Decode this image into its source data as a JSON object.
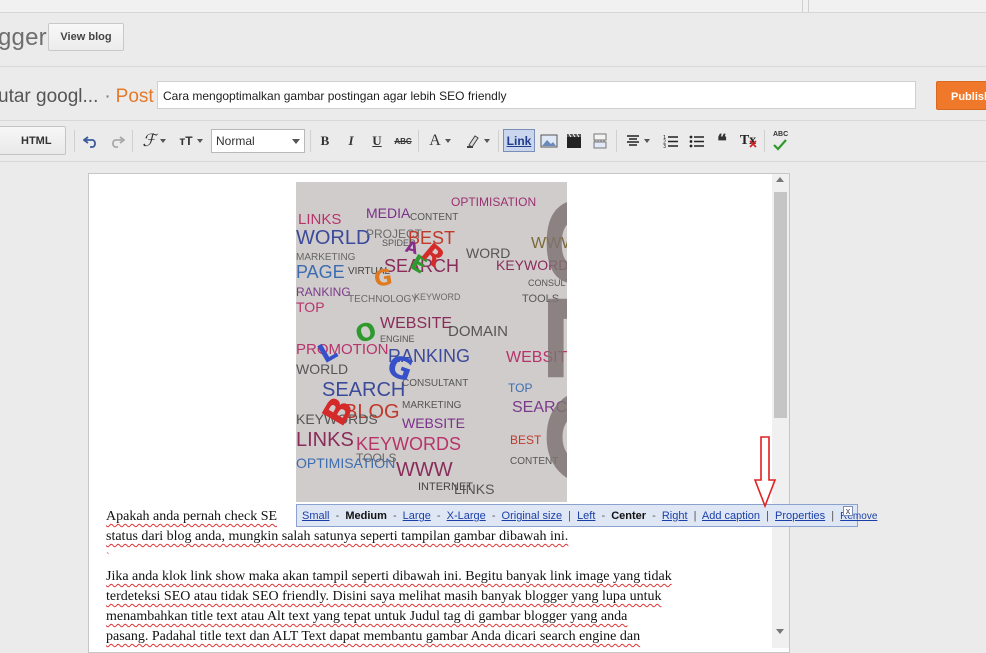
{
  "header": {
    "brand_text": "gger",
    "view_blog_label": "View blog"
  },
  "post_header": {
    "blog_title": "utar googl...",
    "separator": "·",
    "post_label": "Post",
    "title_value": "Cara mengoptimalkan gambar postingan agar lebih SEO friendly",
    "publish_label": "Publish"
  },
  "toolbar": {
    "html_label": "HTML",
    "undo_icon": "undo-icon",
    "redo_icon": "redo-icon",
    "font_icon": "font-family-icon",
    "font_size_icon": "font-size-icon",
    "format_value": "Normal",
    "bold_label": "B",
    "italic_label": "I",
    "underline_label": "U",
    "strike_label": "ABC",
    "text_color_label": "A",
    "link_label": "Link",
    "image_icon": "insert-image-icon",
    "video_icon": "insert-video-icon",
    "jump_break_icon": "jump-break-icon",
    "align_icon": "align-icon",
    "numbered_list_icon": "numbered-list-icon",
    "bullet_list_icon": "bullet-list-icon",
    "quote_label": "❝",
    "remove_format_label": "Tx",
    "spellcheck_label": "ABC"
  },
  "image_toolbar": {
    "small": "Small",
    "medium": "Medium",
    "large": "Large",
    "xlarge": "X-Large",
    "original": "Original size",
    "left": "Left",
    "center": "Center",
    "right": "Right",
    "add_caption": "Add caption",
    "properties": "Properties",
    "remove": "Remove",
    "dash": "-",
    "pipe": "|",
    "close_label": "x"
  },
  "content": {
    "para1_line1": "Apakah anda pernah check SE",
    "para1_line2": "status dari blog anda, mungkin salah satunya seperti tampilan gambar dibawah ini.",
    "stray_mark": "`",
    "para2_line1": "Jika anda klok link show maka akan tampil seperti dibawah ini. Begitu banyak link image yang tidak",
    "para2_line2": "terdeteksi SEO atau tidak SEO friendly. Disini saya melihat masih banyak blogger yang lupa untuk",
    "para2_line3": "menambahkan title text atau Alt text yang  tepat untuk Judul tag di gambar blogger  yang anda",
    "para2_line4": "pasang. Padahal title text dan ALT Text dapat  membantu gambar Anda dicari search engine dan"
  },
  "image_words": {
    "big": "SEO",
    "brand": "BLOGGER",
    "w01": "LINKS",
    "w02": "MEDIA",
    "w03": "CONTENT",
    "w04": "OPTIMISATION",
    "w05": "WORLD",
    "w06": "PROJECT",
    "w07": "BEST",
    "w08": "WWW",
    "w09": "MARKETING",
    "w10": "KEYWORDS",
    "w11": "SEARCH",
    "w12": "PAGE",
    "w13": "VIRTUAL",
    "w14": "WORD",
    "w15": "RANKING",
    "w16": "TOOLS",
    "w17": "TECHNOLOGY",
    "w18": "KEYWORD",
    "w19": "TOP",
    "w20": "WEBSITE",
    "w21": "CONSULTANT",
    "w22": "INTERNET",
    "w23": "PROMOTION",
    "w24": "DOMAIN",
    "w25": "ENGINE",
    "w26": "SPIDER",
    "w27": "BLOG"
  },
  "colors": {
    "publish": "#f0782a",
    "post_label": "#e5792a",
    "link_active_bg": "#c9d6ee",
    "image_toolbar_bg": "#dfe7f5",
    "annotation_arrow": "#e02020"
  }
}
